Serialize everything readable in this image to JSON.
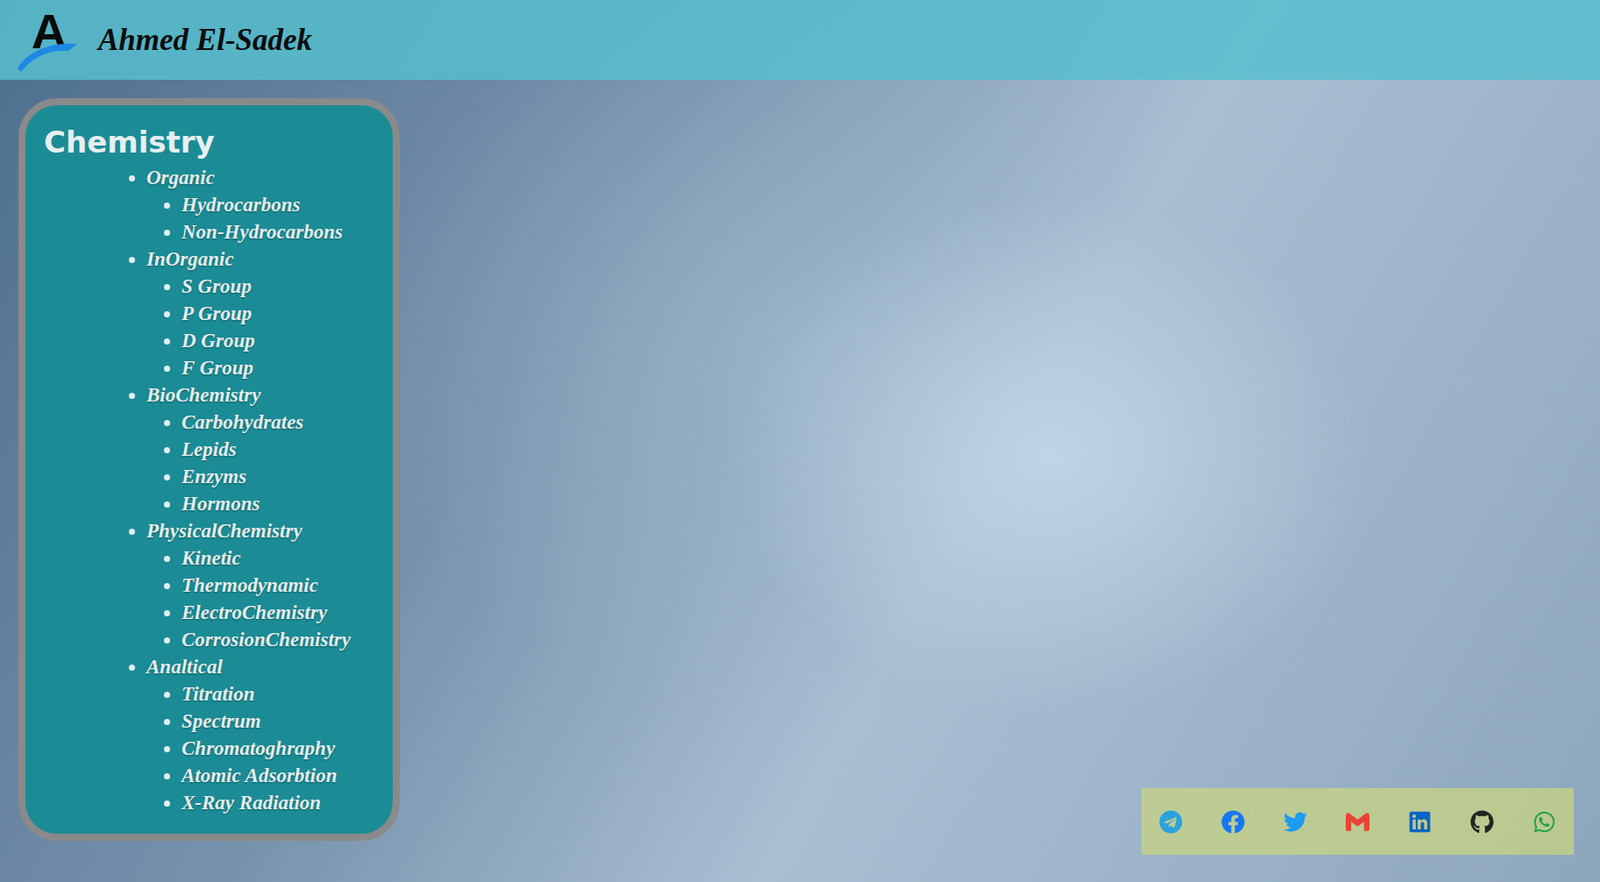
{
  "header": {
    "logo_letter": "A",
    "title": "Ahmed El-Sadek"
  },
  "sidebar": {
    "title": "Chemistry",
    "sections": [
      {
        "label": "Organic",
        "items": [
          "Hydrocarbons",
          "Non-Hydrocarbons"
        ]
      },
      {
        "label": "InOrganic",
        "items": [
          "S Group",
          "P Group",
          "D Group",
          "F Group"
        ]
      },
      {
        "label": "BioChemistry",
        "items": [
          "Carbohydrates",
          "Lepids",
          "Enzyms",
          "Hormons"
        ]
      },
      {
        "label": "PhysicalChemistry",
        "items": [
          "Kinetic",
          "Thermodynamic",
          "ElectroChemistry",
          "CorrosionChemistry"
        ]
      },
      {
        "label": "Analtical",
        "items": [
          "Titration",
          "Spectrum",
          "Chromatoghraphy",
          "Atomic Adsorbtion",
          "X-Ray Radiation"
        ]
      }
    ]
  }
}
